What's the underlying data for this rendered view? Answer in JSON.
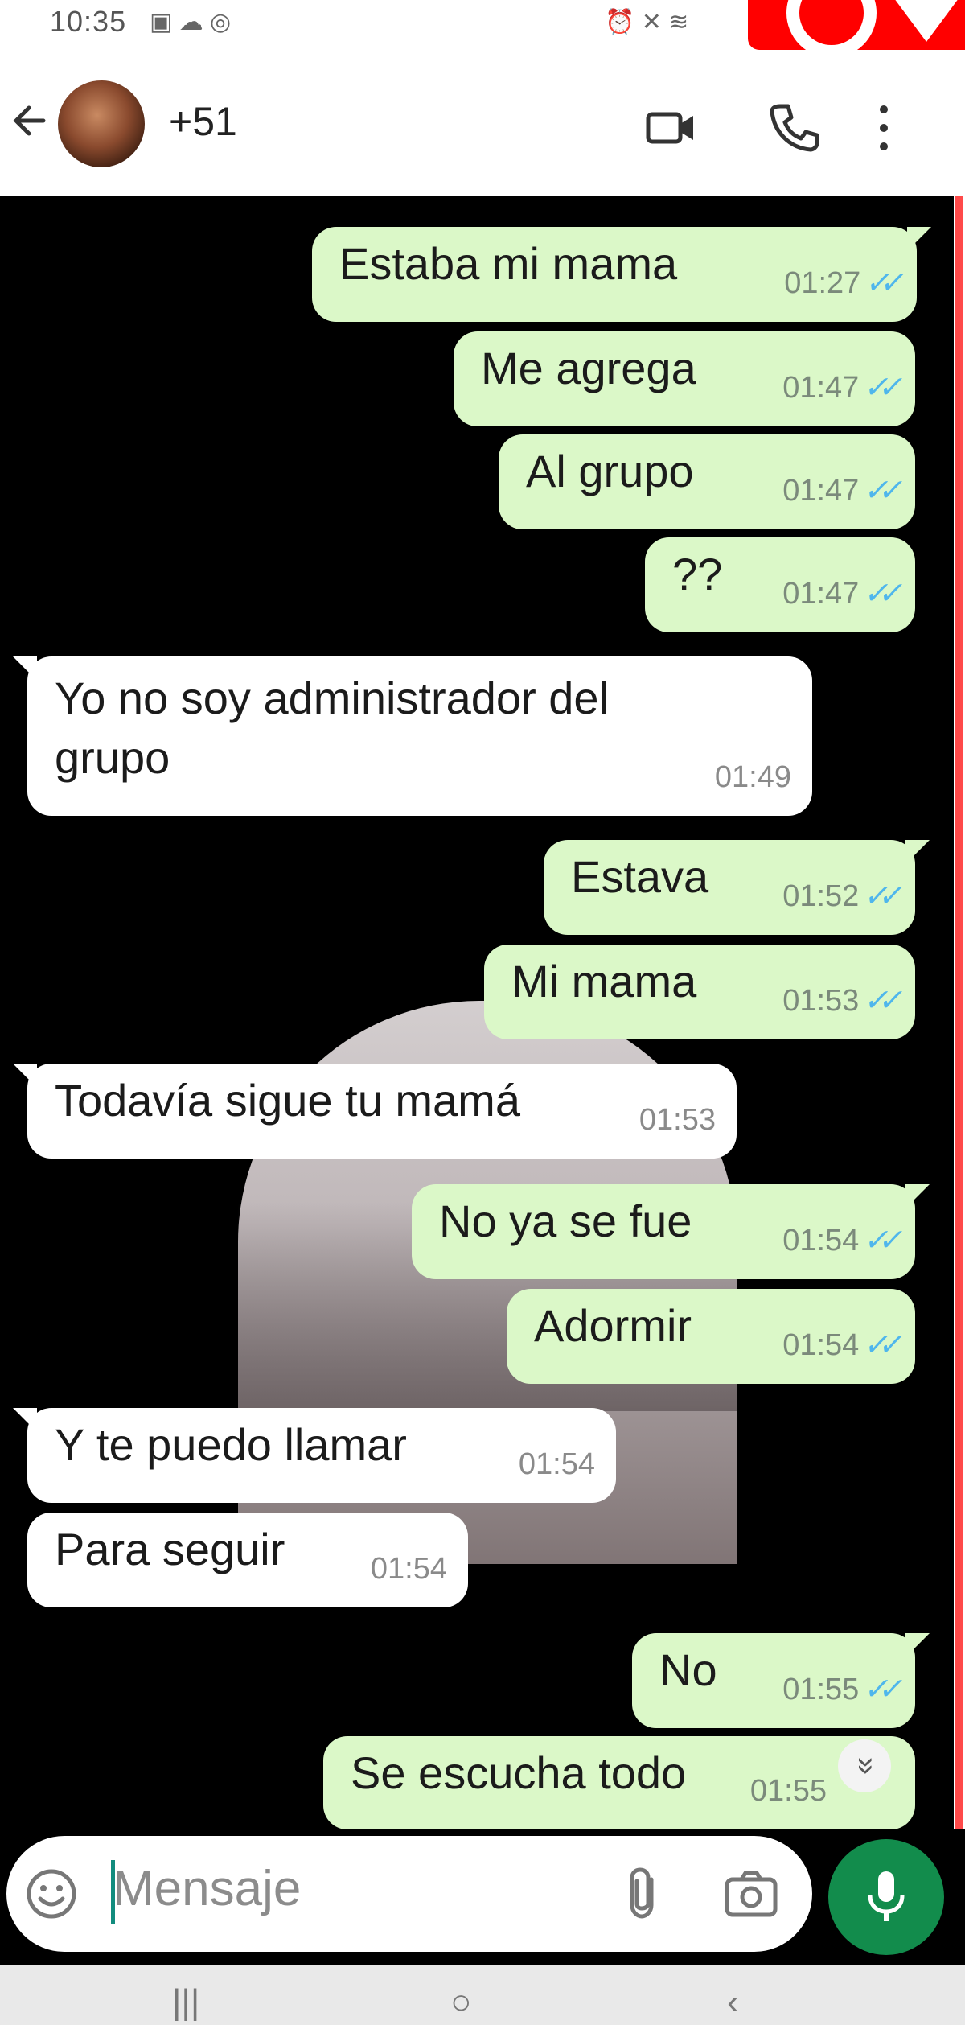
{
  "status_bar": {
    "time": "10:35",
    "icons_left": "▣ ☁ ◎",
    "icons_right": "⏰ ✕ ≋"
  },
  "header": {
    "contact": "+51",
    "icons": [
      "back-arrow-icon",
      "video-call-icon",
      "phone-call-icon",
      "more-options-icon"
    ]
  },
  "messages": [
    {
      "dir": "out",
      "text": "Estaba mi mama",
      "time": "01:27"
    },
    {
      "dir": "out",
      "text": "Me agrega",
      "time": "01:47"
    },
    {
      "dir": "out",
      "text": "Al grupo",
      "time": "01:47"
    },
    {
      "dir": "out",
      "text": "??",
      "time": "01:47"
    },
    {
      "dir": "in",
      "text_line1": "Yo no soy administrador del",
      "text_line2": "grupo",
      "time": "01:49"
    },
    {
      "dir": "out",
      "text": "Estava",
      "time": "01:52"
    },
    {
      "dir": "out",
      "text": "Mi mama",
      "time": "01:53"
    },
    {
      "dir": "in",
      "text": "Todavía sigue tu mamá",
      "time": "01:53"
    },
    {
      "dir": "out",
      "text": "No ya se fue",
      "time": "01:54"
    },
    {
      "dir": "out",
      "text": "Adormir",
      "time": "01:54"
    },
    {
      "dir": "in",
      "text": "Y te puedo llamar",
      "time": "01:54"
    },
    {
      "dir": "in",
      "text": "Para seguir",
      "time": "01:54"
    },
    {
      "dir": "out",
      "text": "No",
      "time": "01:55"
    },
    {
      "dir": "out",
      "text": "Se escucha todo",
      "time": "01:55"
    }
  ],
  "read_tick": "✓✓",
  "scroll_down_glyph": "»",
  "composer": {
    "placeholder": "Mensaje",
    "icons": [
      "emoji-icon",
      "attach-icon",
      "camera-icon",
      "microphone-icon"
    ]
  },
  "nav": {
    "recent": "|||",
    "home": "○",
    "back": "‹"
  },
  "colors": {
    "outgoing_bubble": "#dbf8c8",
    "incoming_bubble": "#ffffff",
    "chat_background": "#000000",
    "read_tick": "#4fb6ec",
    "mic_button": "#128c4c"
  }
}
